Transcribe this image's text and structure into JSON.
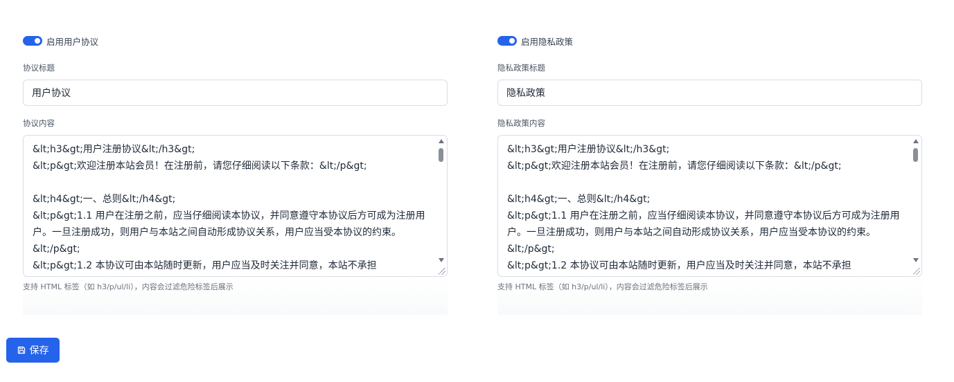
{
  "colors": {
    "accent": "#2563eb",
    "border": "#d9dde3",
    "help_text": "#6b7280"
  },
  "user_agreement": {
    "toggle_label": "启用用户协议",
    "enabled": true,
    "title_label": "协议标题",
    "title_value": "用户协议",
    "content_label": "协议内容",
    "content_value": "&lt;h3&gt;用户注册协议&lt;/h3&gt;\n&lt;p&gt;欢迎注册本站会员！在注册前，请您仔细阅读以下条款：&lt;/p&gt;\n\n&lt;h4&gt;一、总则&lt;/h4&gt;\n&lt;p&gt;1.1 用户在注册之前，应当仔细阅读本协议，并同意遵守本协议后方可成为注册用户。一旦注册成功，则用户与本站之间自动形成协议关系，用户应当受本协议的约束。&lt;/p&gt;\n&lt;p&gt;1.2 本协议可由本站随时更新，用户应当及时关注并同意，本站不承担",
    "help_text": "支持 HTML 标签（如 h3/p/ul/li），内容会过滤危险标签后展示"
  },
  "privacy_policy": {
    "toggle_label": "启用隐私政策",
    "enabled": true,
    "title_label": "隐私政策标题",
    "title_value": "隐私政策",
    "content_label": "隐私政策内容",
    "content_value": "&lt;h3&gt;用户注册协议&lt;/h3&gt;\n&lt;p&gt;欢迎注册本站会员！在注册前，请您仔细阅读以下条款：&lt;/p&gt;\n\n&lt;h4&gt;一、总则&lt;/h4&gt;\n&lt;p&gt;1.1 用户在注册之前，应当仔细阅读本协议，并同意遵守本协议后方可成为注册用户。一旦注册成功，则用户与本站之间自动形成协议关系，用户应当受本协议的约束。&lt;/p&gt;\n&lt;p&gt;1.2 本协议可由本站随时更新，用户应当及时关注并同意，本站不承担",
    "help_text": "支持 HTML 标签（如 h3/p/ul/li），内容会过滤危险标签后展示"
  },
  "actions": {
    "save_label": "保存",
    "save_icon": "save-icon"
  }
}
